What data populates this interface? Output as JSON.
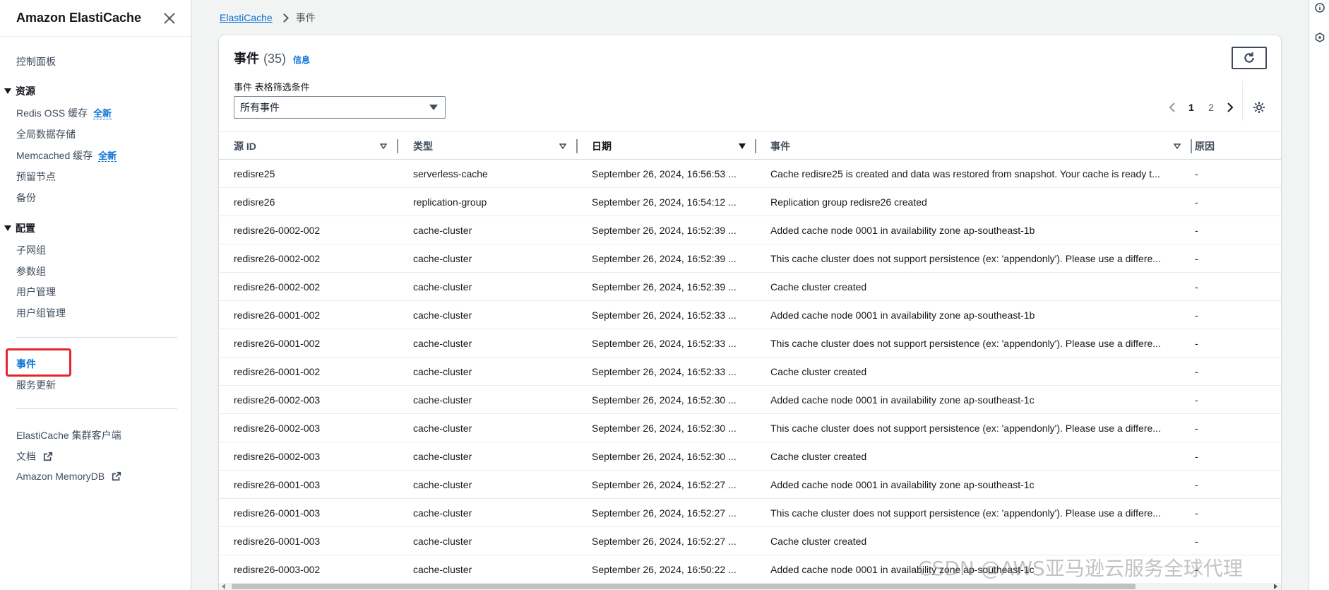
{
  "sidebar": {
    "title": "Amazon ElastiCache",
    "dashboard": "控制面板",
    "sections": {
      "resources": "资源",
      "config": "配置"
    },
    "resources": {
      "redis_oss": "Redis OSS 缓存",
      "global_datastore": "全局数据存储",
      "memcached": "Memcached 缓存",
      "reserved_nodes": "预留节点",
      "backups": "备份"
    },
    "config": {
      "subnet_groups": "子网组",
      "parameter_groups": "参数组",
      "user_management": "用户管理",
      "user_group_management": "用户组管理"
    },
    "new_badge": "全新",
    "events": "事件",
    "service_updates": "服务更新",
    "cluster_client": "ElastiCache 集群客户端",
    "docs": "文档",
    "memorydb": "Amazon MemoryDB"
  },
  "breadcrumb": {
    "root": "ElastiCache",
    "current": "事件"
  },
  "panel": {
    "title": "事件",
    "count": "(35)",
    "info": "信息",
    "filter_label": "事件 表格筛选条件",
    "filter_value": "所有事件",
    "pages": [
      "1",
      "2"
    ]
  },
  "table": {
    "headers": {
      "source_id": "源 ID",
      "type": "类型",
      "date": "日期",
      "event": "事件",
      "reason": "原因"
    },
    "rows": [
      {
        "id": "redisre25",
        "type": "serverless-cache",
        "date": "September 26, 2024, 16:56:53 ...",
        "event": "Cache redisre25 is created and data was restored from snapshot. Your cache is ready t...",
        "reason": "-"
      },
      {
        "id": "redisre26",
        "type": "replication-group",
        "date": "September 26, 2024, 16:54:12 ...",
        "event": "Replication group redisre26 created",
        "reason": "-"
      },
      {
        "id": "redisre26-0002-002",
        "type": "cache-cluster",
        "date": "September 26, 2024, 16:52:39 ...",
        "event": "Added cache node 0001 in availability zone ap-southeast-1b",
        "reason": "-"
      },
      {
        "id": "redisre26-0002-002",
        "type": "cache-cluster",
        "date": "September 26, 2024, 16:52:39 ...",
        "event": "This cache cluster does not support persistence (ex: 'appendonly'). Please use a differe...",
        "reason": "-"
      },
      {
        "id": "redisre26-0002-002",
        "type": "cache-cluster",
        "date": "September 26, 2024, 16:52:39 ...",
        "event": "Cache cluster created",
        "reason": "-"
      },
      {
        "id": "redisre26-0001-002",
        "type": "cache-cluster",
        "date": "September 26, 2024, 16:52:33 ...",
        "event": "Added cache node 0001 in availability zone ap-southeast-1b",
        "reason": "-"
      },
      {
        "id": "redisre26-0001-002",
        "type": "cache-cluster",
        "date": "September 26, 2024, 16:52:33 ...",
        "event": "This cache cluster does not support persistence (ex: 'appendonly'). Please use a differe...",
        "reason": "-"
      },
      {
        "id": "redisre26-0001-002",
        "type": "cache-cluster",
        "date": "September 26, 2024, 16:52:33 ...",
        "event": "Cache cluster created",
        "reason": "-"
      },
      {
        "id": "redisre26-0002-003",
        "type": "cache-cluster",
        "date": "September 26, 2024, 16:52:30 ...",
        "event": "Added cache node 0001 in availability zone ap-southeast-1c",
        "reason": "-"
      },
      {
        "id": "redisre26-0002-003",
        "type": "cache-cluster",
        "date": "September 26, 2024, 16:52:30 ...",
        "event": "This cache cluster does not support persistence (ex: 'appendonly'). Please use a differe...",
        "reason": "-"
      },
      {
        "id": "redisre26-0002-003",
        "type": "cache-cluster",
        "date": "September 26, 2024, 16:52:30 ...",
        "event": "Cache cluster created",
        "reason": "-"
      },
      {
        "id": "redisre26-0001-003",
        "type": "cache-cluster",
        "date": "September 26, 2024, 16:52:27 ...",
        "event": "Added cache node 0001 in availability zone ap-southeast-1c",
        "reason": "-"
      },
      {
        "id": "redisre26-0001-003",
        "type": "cache-cluster",
        "date": "September 26, 2024, 16:52:27 ...",
        "event": "This cache cluster does not support persistence (ex: 'appendonly'). Please use a differe...",
        "reason": "-"
      },
      {
        "id": "redisre26-0001-003",
        "type": "cache-cluster",
        "date": "September 26, 2024, 16:52:27 ...",
        "event": "Cache cluster created",
        "reason": "-"
      },
      {
        "id": "redisre26-0003-002",
        "type": "cache-cluster",
        "date": "September 26, 2024, 16:50:22 ...",
        "event": "Added cache node 0001 in availability zone ap-southeast-1c",
        "reason": "-"
      }
    ]
  },
  "watermark": "CSDN @AWS亚马逊云服务全球代理",
  "colors": {
    "link": "#0972d3",
    "highlight": "#e3262d",
    "text": "#16191f",
    "muted": "#545b64"
  }
}
